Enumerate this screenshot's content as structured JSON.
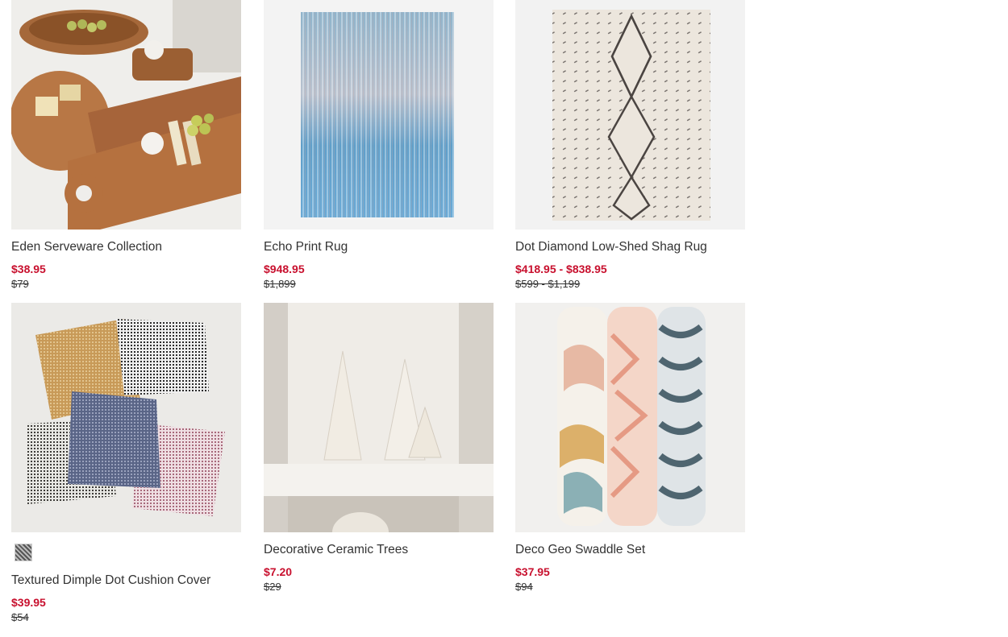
{
  "products": [
    {
      "name": "Eden Serveware Collection",
      "sale_price": "$38.95",
      "original_price": "$79",
      "image_icon": "serveware-boards-image"
    },
    {
      "name": "Echo Print Rug",
      "sale_price": "$948.95",
      "original_price": "$1,899",
      "image_icon": "blue-rug-image"
    },
    {
      "name": "Dot Diamond Low-Shed Shag Rug",
      "sale_price": "$418.95 - $838.95",
      "original_price": "$599 - $1,199",
      "image_icon": "diamond-rug-image"
    },
    {
      "name": "Textured Dimple Dot Cushion Cover",
      "sale_price": "$39.95",
      "original_price": "$54",
      "image_icon": "cushions-image",
      "swatch": "dimple-dot-swatch"
    },
    {
      "name": "Decorative Ceramic Trees",
      "sale_price": "$7.20",
      "original_price": "$29",
      "image_icon": "ceramic-trees-image"
    },
    {
      "name": "Deco Geo Swaddle Set",
      "sale_price": "$37.95",
      "original_price": "$94",
      "image_icon": "swaddle-set-image"
    }
  ],
  "colors": {
    "sale": "#c8102e",
    "text": "#333333"
  }
}
